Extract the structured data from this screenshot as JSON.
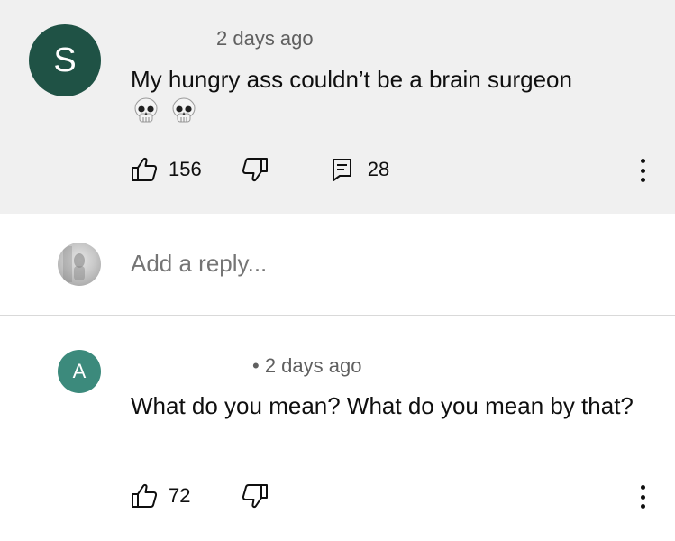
{
  "comments": [
    {
      "avatar_letter": "S",
      "meta": "2 days ago",
      "text": "My hungry ass couldn’t be a brain surgeon",
      "emoji_icons": [
        "skull-icon",
        "skull-icon"
      ],
      "likes": "156",
      "replies": "28"
    },
    {
      "avatar_letter": "A",
      "meta": "• 2 days ago",
      "text": "What do you mean? What do you mean by that?",
      "likes": "72"
    }
  ],
  "reply_box": {
    "placeholder": "Add a reply..."
  },
  "colors": {
    "highlight_bg": "#f0f0f0",
    "avatar_s": "#1f5245",
    "avatar_a": "#3c8a7c",
    "secondary_text": "#606060",
    "primary_text": "#0f0f0f"
  }
}
